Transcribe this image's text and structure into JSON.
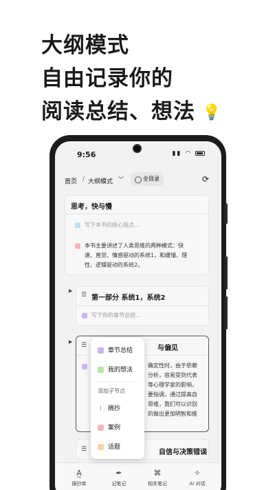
{
  "headline": {
    "line1": "大纲模式",
    "line2": "自由记录你的",
    "line3": "阅读总结、想法"
  },
  "status": {
    "time": "9:56"
  },
  "nav": {
    "home": "首页",
    "separator": "/",
    "mode": "大纲模式",
    "toc": "全目录"
  },
  "card1": {
    "title": "思考，快与慢",
    "placeholder": "写下本书的核心观点...",
    "summary_lines": [
      "本书主要讲述了人类思维的两种模式：快",
      "速、直觉、情感驱动的系统1，和缓慢、理",
      "性、逻辑驱动的系统2。"
    ]
  },
  "card2": {
    "title": "第一部分  系统1，系统2",
    "placeholder": "写下你的章节总结..."
  },
  "card3": {
    "title_visible": "与偏见",
    "lines": [
      "确定性时，由于依赖",
      "分析，容易受到代表",
      "等心理学家的影响，",
      "要指调，通过提高自",
      "思维，我们可以识别",
      "的做出更加明智和推"
    ]
  },
  "card4": {
    "title_visible": "自信与决策错误"
  },
  "menu": {
    "items_top": [
      "章节总结",
      "我的想法"
    ],
    "section": "添加子节点",
    "items_sub": [
      "摘抄",
      "案例",
      "话题"
    ]
  },
  "bottom_tabs": [
    "摘抄库",
    "记笔记",
    "相关笔记",
    "AI 对话"
  ],
  "colors": {
    "highlight": "#d8f26a",
    "tag_summary": "#c9b8f0",
    "tag_idea": "#b9e6a8",
    "tag_case": "#f4b6b6",
    "tag_topic": "#f6d3a8"
  }
}
